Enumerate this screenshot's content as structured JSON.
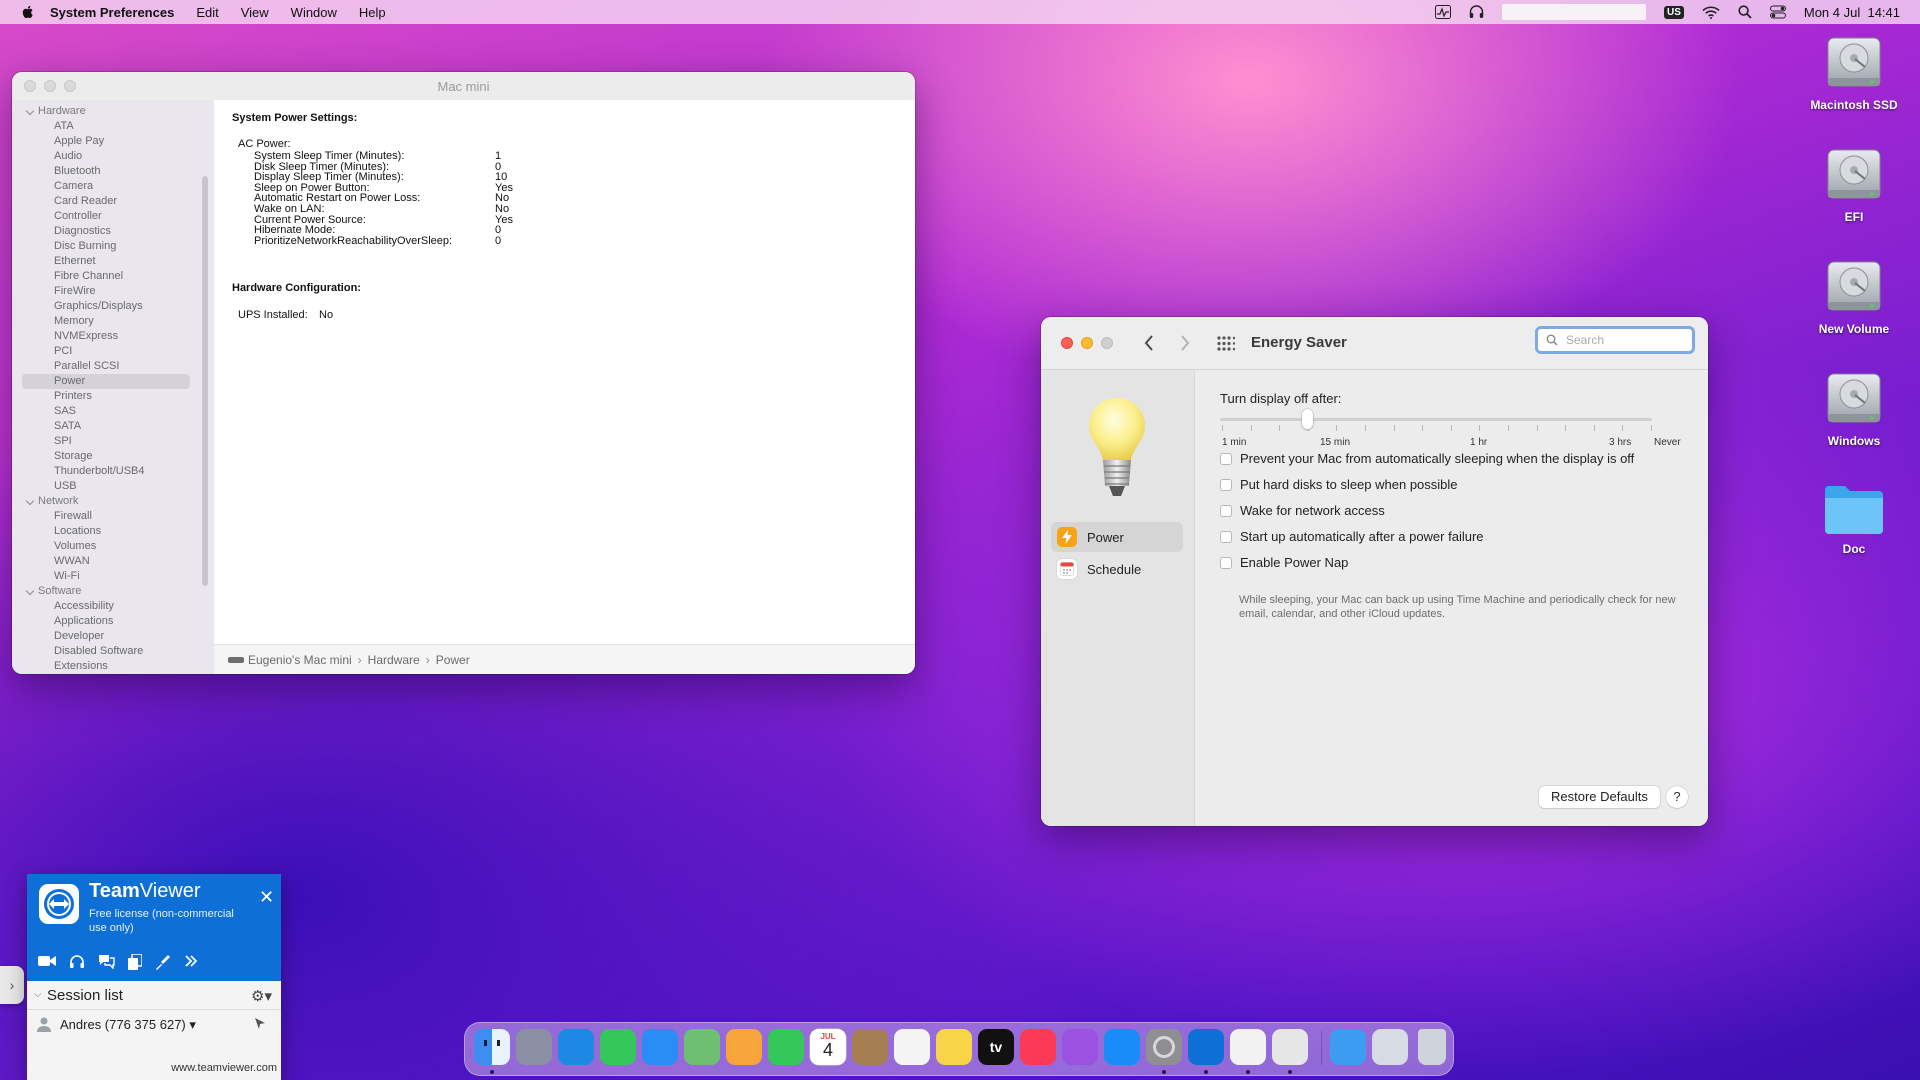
{
  "menubar": {
    "app_name": "System Preferences",
    "items": [
      "Edit",
      "View",
      "Window",
      "Help"
    ],
    "input_source": "US",
    "datetime": "Mon 4 Jul  14:41"
  },
  "sysinfo": {
    "title": "Mac mini",
    "sidebar": {
      "hardware_label": "Hardware",
      "hardware": [
        "ATA",
        "Apple Pay",
        "Audio",
        "Bluetooth",
        "Camera",
        "Card Reader",
        "Controller",
        "Diagnostics",
        "Disc Burning",
        "Ethernet",
        "Fibre Channel",
        "FireWire",
        "Graphics/Displays",
        "Memory",
        "NVMExpress",
        "PCI",
        "Parallel SCSI",
        "Power",
        "Printers",
        "SAS",
        "SATA",
        "SPI",
        "Storage",
        "Thunderbolt/USB4",
        "USB"
      ],
      "network_label": "Network",
      "network": [
        "Firewall",
        "Locations",
        "Volumes",
        "WWAN",
        "Wi-Fi"
      ],
      "software_label": "Software",
      "software": [
        "Accessibility",
        "Applications",
        "Developer",
        "Disabled Software",
        "Extensions"
      ],
      "selected": "Power"
    },
    "content": {
      "section1": "System Power Settings:",
      "ac_power": "AC Power:",
      "ac_rows": [
        {
          "k": "System Sleep Timer (Minutes):",
          "v": "1"
        },
        {
          "k": "Disk Sleep Timer (Minutes):",
          "v": "0"
        },
        {
          "k": "Display Sleep Timer (Minutes):",
          "v": "10"
        },
        {
          "k": "Sleep on Power Button:",
          "v": "Yes"
        },
        {
          "k": "Automatic Restart on Power Loss:",
          "v": "No"
        },
        {
          "k": "Wake on LAN:",
          "v": "No"
        },
        {
          "k": "Current Power Source:",
          "v": "Yes"
        },
        {
          "k": "Hibernate Mode:",
          "v": "0"
        },
        {
          "k": "PrioritizeNetworkReachabilityOverSleep:",
          "v": "0"
        }
      ],
      "section2": "Hardware Configuration:",
      "ups_label": "UPS Installed:",
      "ups_value": "No"
    },
    "path": [
      "Eugenio's Mac mini",
      "Hardware",
      "Power"
    ]
  },
  "energy": {
    "title": "Energy Saver",
    "search_placeholder": "Search",
    "nav": [
      {
        "label": "Power",
        "icon": "power-bolt-icon",
        "selected": true
      },
      {
        "label": "Schedule",
        "icon": "calendar-icon",
        "selected": false
      }
    ],
    "slider_label": "Turn display off after:",
    "slider_ticks": [
      "1 min",
      "15 min",
      "1 hr",
      "3 hrs",
      "Never"
    ],
    "slider_value": "10 min",
    "checkboxes": [
      {
        "label": "Prevent your Mac from automatically sleeping when the display is off",
        "checked": false
      },
      {
        "label": "Put hard disks to sleep when possible",
        "checked": false
      },
      {
        "label": "Wake for network access",
        "checked": false
      },
      {
        "label": "Start up automatically after a power failure",
        "checked": false
      },
      {
        "label": "Enable Power Nap",
        "checked": false
      }
    ],
    "power_nap_note": "While sleeping, your Mac can back up using Time Machine and periodically check for new email, calendar, and other iCloud updates.",
    "restore_label": "Restore Defaults",
    "help_label": "?"
  },
  "desktop_icons": [
    {
      "label": "Macintosh SSD",
      "icon": "hard-drive-icon"
    },
    {
      "label": "EFI",
      "icon": "hard-drive-icon"
    },
    {
      "label": "New Volume",
      "icon": "hard-drive-icon"
    },
    {
      "label": "Windows",
      "icon": "hard-drive-icon"
    },
    {
      "label": "Doc",
      "icon": "folder-icon"
    }
  ],
  "teamviewer": {
    "brand_bold": "Team",
    "brand_rest": "Viewer",
    "license": "Free license (non-commercial use only)",
    "session_list": "Session list",
    "session": "Andres (776 375 627)",
    "website": "www.teamviewer.com"
  },
  "dock": {
    "apps": [
      "Finder",
      "Launchpad",
      "Safari",
      "Messages",
      "Mail",
      "Maps",
      "Photos",
      "FaceTime",
      "Calendar",
      "Contacts",
      "Reminders",
      "Notes",
      "TV",
      "Music",
      "Podcasts",
      "App Store",
      "System Preferences",
      "TeamViewer",
      "TextEdit",
      "Preview",
      "Downloads",
      "Screenshot",
      "Trash"
    ],
    "calendar_month": "JUL",
    "calendar_day": "4",
    "tv_label": "tv",
    "colors": [
      "#3d8ef0",
      "#8a8fa3",
      "#1e88e5",
      "#34c759",
      "#2a8cf5",
      "#6fbf73",
      "#f6a53a",
      "#34c759",
      "#ffffff",
      "#a57f52",
      "#f4f4f4",
      "#f8d548",
      "#111111",
      "#fb3a57",
      "#9b52e0",
      "#1a8cf8",
      "#8e8e93",
      "#0e6fd6",
      "#f2f2f2",
      "#e6e6e6",
      "#3c9cf2",
      "#d7dbe3",
      "#cfd3da"
    ]
  }
}
